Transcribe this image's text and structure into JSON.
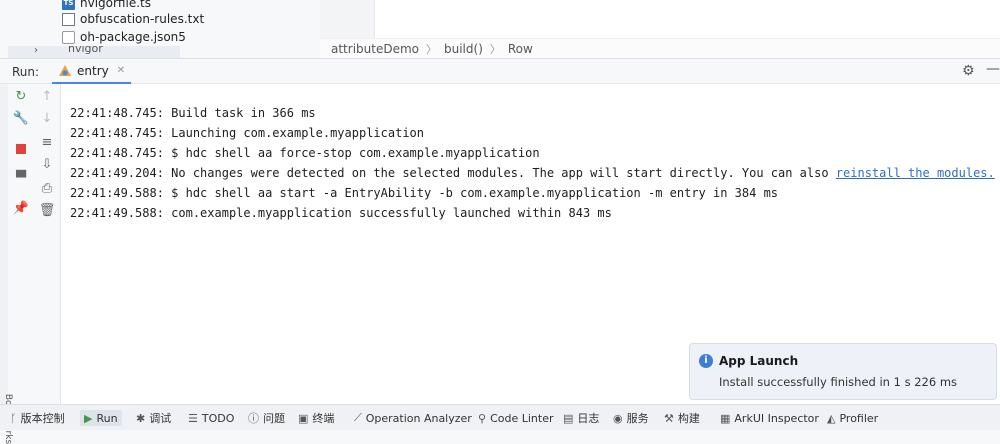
{
  "project_tree": {
    "items": [
      {
        "label": "hvigorfile.ts",
        "icon": "typescript-file-icon"
      },
      {
        "label": "obfuscation-rules.txt",
        "icon": "text-file-icon"
      },
      {
        "label": "oh-package.json5",
        "icon": "json5-file-icon"
      }
    ],
    "folder": {
      "label": "hvigor",
      "icon": "chevron-right-icon"
    }
  },
  "editor": {
    "breadcrumb": [
      "attributeDemo",
      "build()",
      "Row"
    ]
  },
  "run_panel": {
    "label": "Run:",
    "tab": {
      "label": "entry",
      "icon": "entry-module-icon"
    }
  },
  "console": {
    "lines": [
      {
        "text": "22:41:48.745: Build task in 366 ms"
      },
      {
        "text": "22:41:48.745: Launching com.example.myapplication"
      },
      {
        "text": "22:41:48.745: $ hdc shell aa force-stop com.example.myapplication"
      },
      {
        "text": "22:41:49.204: No changes were detected on the selected modules. The app will start directly. You can also ",
        "link": "reinstall the modules."
      },
      {
        "text": "22:41:49.588: $ hdc shell aa start -a EntryAbility -b com.example.myapplication -m entry in 384 ms"
      },
      {
        "text": "22:41:49.588: com.example.myapplication successfully launched within 843 ms"
      }
    ]
  },
  "notification": {
    "title": "App Launch",
    "message": "Install successfully finished in 1 s 226 ms",
    "icon": "info-icon"
  },
  "sidebar": {
    "bookmarks_label": "Bookmarks"
  },
  "statusbar": {
    "items": [
      {
        "label": "版本控制",
        "icon": "version-control-icon"
      },
      {
        "label": "Run",
        "icon": "run-icon",
        "active": true
      },
      {
        "label": "调试",
        "icon": "debug-icon"
      },
      {
        "label": "TODO",
        "icon": "todo-icon"
      },
      {
        "label": "问题",
        "icon": "problems-icon"
      },
      {
        "label": "终端",
        "icon": "terminal-icon"
      },
      {
        "label": "Operation Analyzer",
        "icon": "operation-analyzer-icon"
      },
      {
        "label": "Code Linter",
        "icon": "code-linter-icon"
      },
      {
        "label": "日志",
        "icon": "log-icon"
      },
      {
        "label": "服务",
        "icon": "services-icon"
      },
      {
        "label": "构建",
        "icon": "build-icon"
      },
      {
        "label": "ArkUI Inspector",
        "icon": "arkui-inspector-icon"
      },
      {
        "label": "Profiler",
        "icon": "profiler-icon"
      }
    ]
  },
  "colors": {
    "accent": "#4a86e8",
    "link": "#2f6fc0",
    "info": "#3d7ed8",
    "stop": "#e0433b",
    "rerun": "#3f9b4b"
  }
}
